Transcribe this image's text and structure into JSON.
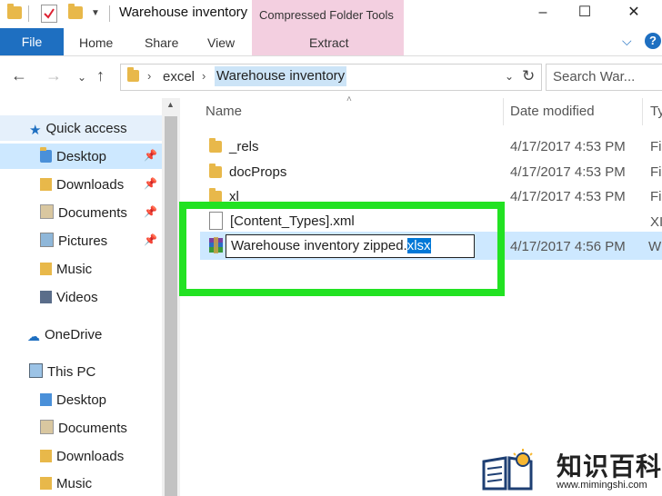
{
  "window": {
    "title": "Warehouse inventory",
    "compressed_tools_label": "Compressed Folder Tools",
    "controls": [
      "–",
      "☐",
      "✕"
    ]
  },
  "ribbon": {
    "file": "File",
    "tabs": [
      "Home",
      "Share",
      "View",
      "Extract"
    ]
  },
  "address": {
    "crumbs": [
      "excel",
      "Warehouse inventory"
    ],
    "search_placeholder": "Search War..."
  },
  "nav": {
    "items": [
      {
        "label": "Quick access",
        "icon": "star-icon"
      },
      {
        "label": "Desktop",
        "icon": "folder-icon",
        "pinned": true
      },
      {
        "label": "Downloads",
        "icon": "downloads-icon",
        "pinned": true
      },
      {
        "label": "Documents",
        "icon": "documents-icon",
        "pinned": true
      },
      {
        "label": "Pictures",
        "icon": "pictures-icon",
        "pinned": true
      },
      {
        "label": "Music",
        "icon": "music-icon"
      },
      {
        "label": "Videos",
        "icon": "videos-icon"
      },
      {
        "label": "OneDrive",
        "icon": "cloud-icon"
      },
      {
        "label": "This PC",
        "icon": "computer-icon"
      },
      {
        "label": "Desktop",
        "icon": "folder-icon"
      },
      {
        "label": "Documents",
        "icon": "documents-icon"
      },
      {
        "label": "Downloads",
        "icon": "downloads-icon"
      },
      {
        "label": "Music",
        "icon": "music-icon"
      }
    ]
  },
  "columns": {
    "name": "Name",
    "date": "Date modified",
    "type": "Ty"
  },
  "files": [
    {
      "name": "_rels",
      "date": "4/17/2017 4:53 PM",
      "type": "Fi"
    },
    {
      "name": "docProps",
      "date": "4/17/2017 4:53 PM",
      "type": "Fi"
    },
    {
      "name": "xl",
      "date": "4/17/2017 4:53 PM",
      "type": "Fi"
    },
    {
      "name": "[Content_Types].xml",
      "date": "",
      "type": "XI"
    }
  ],
  "rename": {
    "base": "Warehouse inventory zipped.",
    "ext": "xlsx",
    "date": "4/17/2017 4:56 PM",
    "type": "W"
  },
  "watermark": {
    "name": "知识百科",
    "url": "www.mimingshi.com"
  },
  "colors": {
    "highlight": "#22e222",
    "file_tab": "#1e6fc1",
    "compressed_tab": "#f3cfe0",
    "selection": "#cde8ff"
  }
}
